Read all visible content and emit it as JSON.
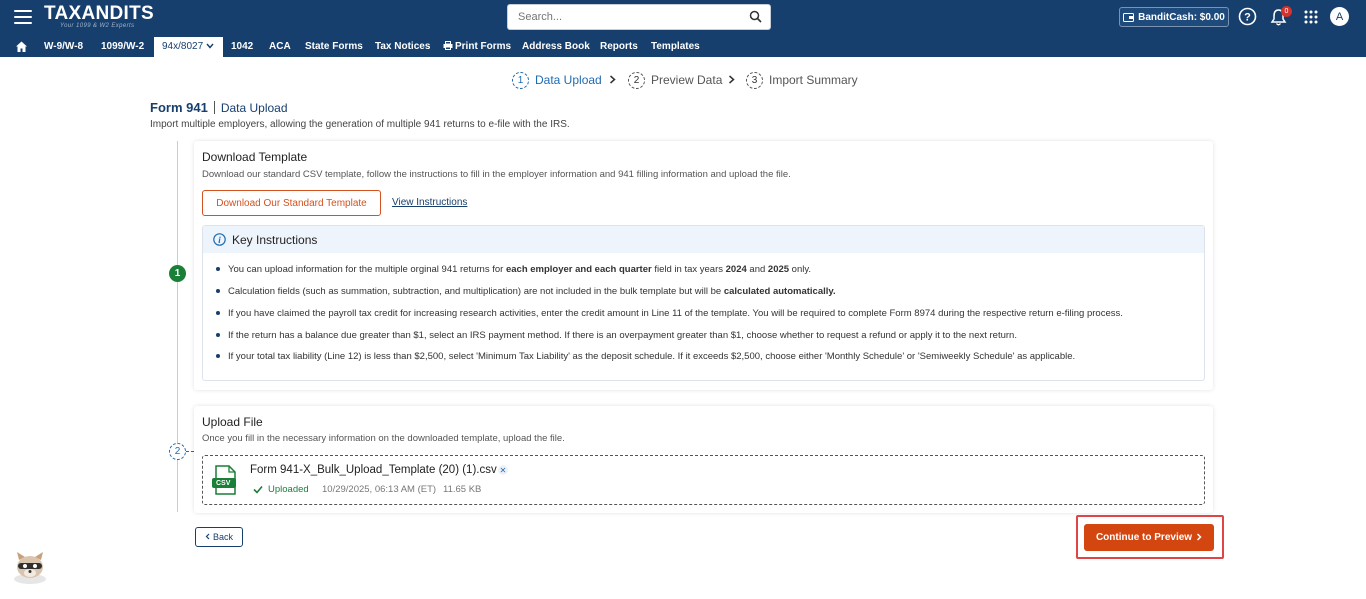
{
  "header": {
    "logo_text": "TAXANDITS",
    "logo_tagline": "Your 1099 & W2 Experts",
    "search_placeholder": "Search...",
    "bandit_cash": "BanditCash: $0.00",
    "notification_count": "0",
    "avatar_letter": "A"
  },
  "nav": {
    "items": [
      "W-9/W-8",
      "1099/W-2",
      "94x/8027",
      "1042",
      "ACA",
      "State Forms",
      "Tax Notices",
      "Print Forms",
      "Address Book",
      "Reports",
      "Templates"
    ]
  },
  "stepper": {
    "steps": [
      {
        "num": "1",
        "label": "Data Upload"
      },
      {
        "num": "2",
        "label": "Preview Data"
      },
      {
        "num": "3",
        "label": "Import Summary"
      }
    ]
  },
  "page": {
    "form_title": "Form 941",
    "form_subtitle": "Data Upload",
    "description": "Import multiple employers, allowing the generation of multiple 941 returns to e-file with the IRS."
  },
  "download": {
    "step_num": "1",
    "heading": "Download Template",
    "text": "Download our standard CSV template, follow the instructions to fill in the employer information and 941 filling information and upload the file.",
    "button_label": "Download Our Standard Template",
    "link_label": "View Instructions"
  },
  "instructions": {
    "heading": "Key Instructions",
    "item1": {
      "a": "You can upload information for the multiple orginal 941 returns for ",
      "b": "each employer and each quarter",
      "c": " field in tax years ",
      "d": "2024",
      "e": " and ",
      "f": "2025",
      "g": " only."
    },
    "item2": {
      "a": "Calculation fields (such as summation, subtraction, and multiplication) are not included in the bulk template but will be ",
      "b": "calculated automatically."
    },
    "item3": "If you have claimed the payroll tax credit for increasing research activities, enter the credit amount in Line 11 of the template. You will be required to complete Form 8974 during the respective return e-filing process.",
    "item4": "If the return has a balance due greater than $1, select an IRS payment method. If there is an overpayment greater than $1, choose whether to request a refund or apply it to the next return.",
    "item5": "If your total tax liability (Line 12) is less than $2,500, select 'Minimum Tax Liability' as the deposit schedule. If it exceeds $2,500, choose either 'Monthly Schedule' or 'Semiweekly Schedule' as applicable."
  },
  "upload": {
    "step_num": "2",
    "heading": "Upload File",
    "text": "Once you fill in the necessary information on the downloaded template, upload the file.",
    "file_name": "Form 941-X_Bulk_Upload_Template (20) (1).csv",
    "file_type": "CSV",
    "status": "Uploaded",
    "timestamp": "10/29/2025, 06:13 AM (ET)",
    "size": "11.65 KB"
  },
  "actions": {
    "back_label": "Back",
    "continue_label": "Continue to Preview"
  },
  "colors": {
    "header_bg": "#173f6d",
    "accent_orange": "#d4460f",
    "success_green": "#1a7f37",
    "highlight_red": "#e04545"
  }
}
